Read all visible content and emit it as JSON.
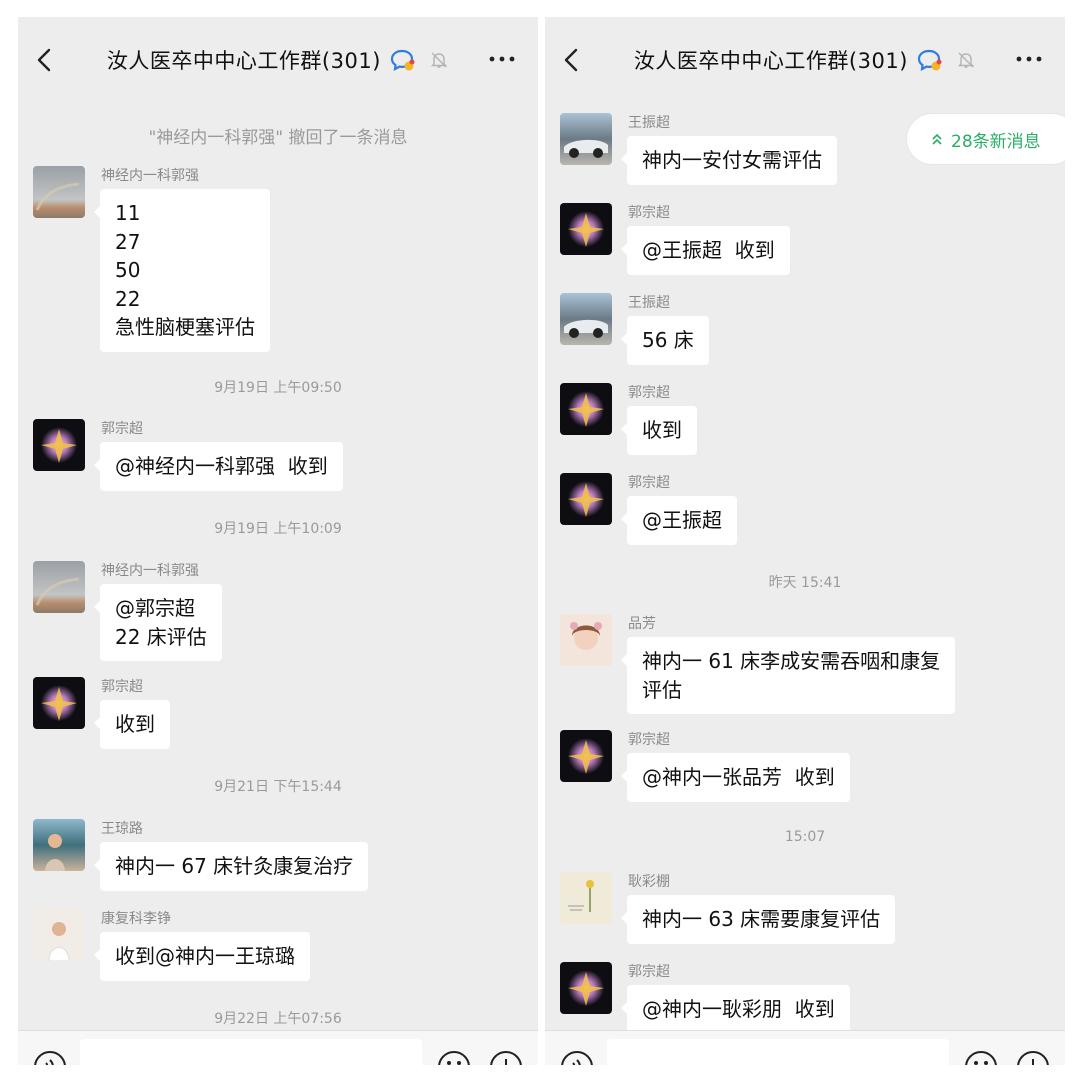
{
  "left": {
    "title": "汝人医卒中中心工作群(301)",
    "recall_notice": "\"神经内一科郭强\" 撤回了一条消息",
    "times": [
      "9月19日 上午09:50",
      "9月19日 上午10:09",
      "9月21日 下午15:44",
      "9月22日 上午07:56"
    ],
    "messages": [
      {
        "sender": "神经内一科郭强",
        "text": "11\n27\n50\n22\n急性脑梗塞评估",
        "avatar": "rainbow-landscape-avatar"
      },
      {
        "sender": "郭宗超",
        "text": "@神经内一科郭强  收到",
        "avatar": "dark-flower-avatar"
      },
      {
        "sender": "神经内一科郭强",
        "text": "@郭宗超\n22 床评估",
        "avatar": "rainbow-landscape-avatar"
      },
      {
        "sender": "郭宗超",
        "text": "收到",
        "avatar": "dark-flower-avatar"
      },
      {
        "sender": "王琼路",
        "text": "神内一 67 床针灸康复治疗",
        "avatar": "beach-portrait-avatar"
      },
      {
        "sender": "康复科李铮",
        "text": "收到@神内一王琼璐",
        "avatar": "child-photo-avatar"
      }
    ]
  },
  "right": {
    "title": "汝人医卒中中心工作群(301)",
    "new_messages": "28条新消息",
    "times": [
      "昨天 15:41",
      "15:07"
    ],
    "messages": [
      {
        "sender": "王振超",
        "text": "神内一安付女需评估",
        "avatar": "car-photo-avatar"
      },
      {
        "sender": "郭宗超",
        "text": "@王振超  收到",
        "avatar": "dark-flower-avatar"
      },
      {
        "sender": "王振超",
        "text": "56 床",
        "avatar": "car-photo-avatar"
      },
      {
        "sender": "郭宗超",
        "text": "收到",
        "avatar": "dark-flower-avatar"
      },
      {
        "sender": "郭宗超",
        "text": "@王振超",
        "avatar": "dark-flower-avatar"
      },
      {
        "sender": "品芳",
        "text": "神内一 61 床李成安需吞咽和康复\n评估",
        "avatar": "girl-portrait-avatar"
      },
      {
        "sender": "郭宗超",
        "text": "@神内一张品芳  收到",
        "avatar": "dark-flower-avatar"
      },
      {
        "sender": "耿彩棚",
        "text": "神内一 63 床需要康复评估",
        "avatar": "flower-card-avatar"
      },
      {
        "sender": "郭宗超",
        "text": "@神内一耿彩朋  收到",
        "avatar": "dark-flower-avatar"
      }
    ]
  },
  "colors": {
    "chat_background": "#ededed",
    "bubble": "#ffffff",
    "new_messages_text": "#2aae67",
    "system_text": "#9a9a9a"
  },
  "icons": [
    "back-icon",
    "group-icon",
    "mute-icon",
    "more-icon",
    "voice-icon",
    "emoji-icon",
    "plus-icon",
    "double-chevron-up-icon"
  ]
}
